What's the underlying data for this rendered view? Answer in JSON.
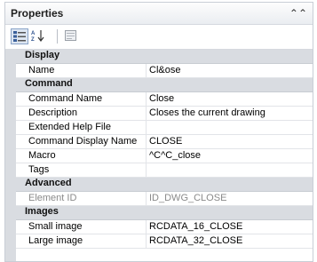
{
  "panel": {
    "title": "Properties"
  },
  "categories": [
    {
      "name": "Display",
      "rows": [
        {
          "key": "Name",
          "value": "Cl&ose",
          "disabled": false
        }
      ]
    },
    {
      "name": "Command",
      "rows": [
        {
          "key": "Command Name",
          "value": "Close",
          "disabled": false
        },
        {
          "key": "Description",
          "value": "Closes the current drawing",
          "disabled": false
        },
        {
          "key": "Extended Help File",
          "value": "",
          "disabled": false
        },
        {
          "key": "Command Display Name",
          "value": "CLOSE",
          "disabled": false
        },
        {
          "key": "Macro",
          "value": "^C^C_close",
          "disabled": false
        },
        {
          "key": "Tags",
          "value": "",
          "disabled": false
        }
      ]
    },
    {
      "name": "Advanced",
      "rows": [
        {
          "key": "Element ID",
          "value": "ID_DWG_CLOSE",
          "disabled": true
        }
      ]
    },
    {
      "name": "Images",
      "rows": [
        {
          "key": "Small image",
          "value": "RCDATA_16_CLOSE",
          "disabled": false
        },
        {
          "key": "Large image",
          "value": "RCDATA_32_CLOSE",
          "disabled": false
        }
      ]
    }
  ],
  "icons": {
    "collapse": "collapse-chevron-icon",
    "categorized": "categorized-view-icon",
    "alphabetical": "alphabetical-sort-icon",
    "pages": "property-pages-icon",
    "expander": "category-expanded-triangle-icon"
  }
}
